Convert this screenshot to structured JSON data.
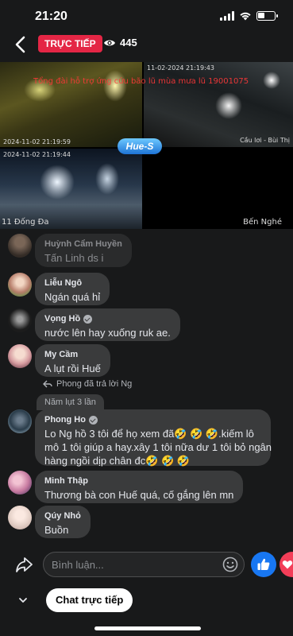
{
  "status_bar": {
    "time": "21:20"
  },
  "top_bar": {
    "live_label": "TRỰC TIẾP",
    "viewer_count": "445"
  },
  "video": {
    "overlay_text": "Tổng đài hỗ trợ ứng cứu bão lũ mùa mưa lũ 19001075",
    "cam1_time": "2024-11-02 21:19:59",
    "cam2_time": "11-02-2024 21:19:43",
    "cam2_label": "Cầu lơi - Bùi Thị",
    "cam3_time": "2024-11-02 21:19:44",
    "cam3_label": "11 Đống Đa",
    "cam4_label": "Bến Nghé",
    "logo_text": "Hue-S"
  },
  "comments": [
    {
      "name": "Huỳnh Cẩm Huyền",
      "text": "Tấn Linh ds i",
      "verified": false,
      "faded": true
    },
    {
      "name": "Liễu Ngô",
      "text": "Ngán quá hỉ",
      "verified": false,
      "faded": false
    },
    {
      "name": "Vọng Hồ",
      "text": "nước lên hay xuống ruk ae.",
      "verified": true,
      "faded": false
    },
    {
      "name": "My Cầm",
      "text": "A lụt rồi Huế",
      "verified": false,
      "faded": false
    },
    {
      "name": "Phong Ho",
      "text_line1": "Lo Ng hồ 3 tôi để họ xem đã🤣 🤣 🤣.kiếm lô",
      "text_line2": "mô 1 tôi giúp a hay.xây 1 tôi nữa dư 1 tôi bỏ ngân",
      "text_line3": "hàng ngồi dịp chân đc🤣 🤣 🤣",
      "verified": true,
      "faded": false
    },
    {
      "name": "Minh Thập",
      "text": "Thương bà con Huế quá, cố gắng lên mn",
      "verified": false,
      "faded": false
    },
    {
      "name": "Qúy Nhỏ",
      "text": "Buồn",
      "verified": false,
      "faded": false
    }
  ],
  "reply_indicator": "Phong đã trả lời Ng",
  "reply_context": "Năm lụt 3 lần",
  "composer": {
    "placeholder": "Bình luận..."
  },
  "chat_button_label": "Chat trực tiếp",
  "colors": {
    "live_red": "#e42645",
    "like_blue": "#1877f2",
    "love_red": "#f33e58",
    "bubble": "#3a3b3c",
    "background": "#18191a"
  },
  "icons": [
    "back-arrow-icon",
    "eye-icon",
    "share-icon",
    "emoji-icon",
    "thumbs-up-icon",
    "heart-icon",
    "chevron-down-icon",
    "verified-icon"
  ]
}
